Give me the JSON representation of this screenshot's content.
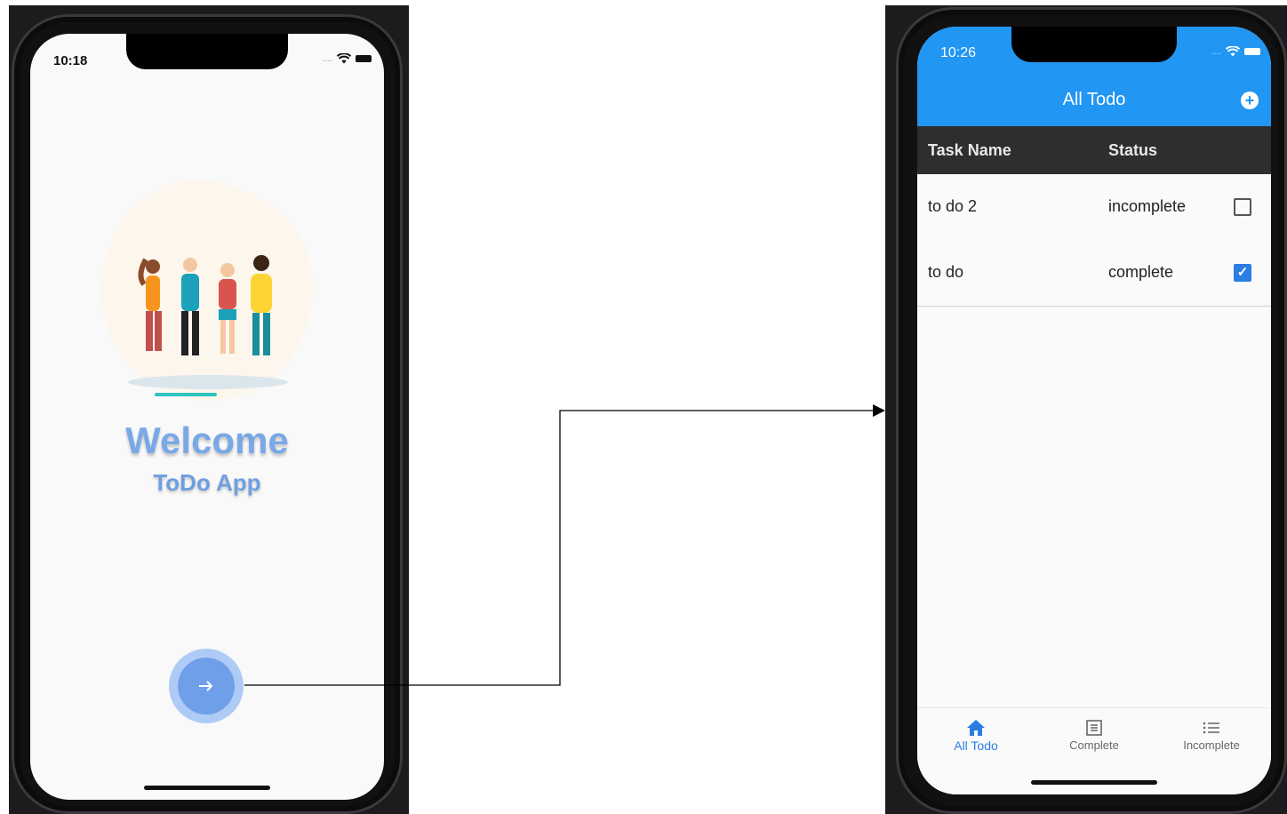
{
  "colors": {
    "accent": "#2196f3",
    "welcome_text": "#7aa8e6",
    "table_header_bg": "#2e2e2e",
    "checkbox_checked": "#2a7de1"
  },
  "left_screen": {
    "status_time": "10:18",
    "signal_text": "....",
    "welcome_title": "Welcome",
    "welcome_subtitle": "ToDo App",
    "illustration": "group-of-friends-illustration",
    "next_button_icon": "arrow-right-icon"
  },
  "right_screen": {
    "status_time": "10:26",
    "signal_text": "....",
    "appbar_title": "All Todo",
    "add_icon": "+",
    "table": {
      "headers": [
        "Task Name",
        "Status"
      ],
      "rows": [
        {
          "name": "to do 2",
          "status": "incomplete",
          "checked": false,
          "check_mark": ""
        },
        {
          "name": "to do",
          "status": "complete",
          "checked": true,
          "check_mark": "✓"
        }
      ]
    },
    "bottom_nav": [
      {
        "label": "All Todo",
        "icon": "home-icon",
        "active": true
      },
      {
        "label": "Complete",
        "icon": "list-box-icon",
        "active": false
      },
      {
        "label": "Incomplete",
        "icon": "list-icon",
        "active": false
      }
    ]
  }
}
